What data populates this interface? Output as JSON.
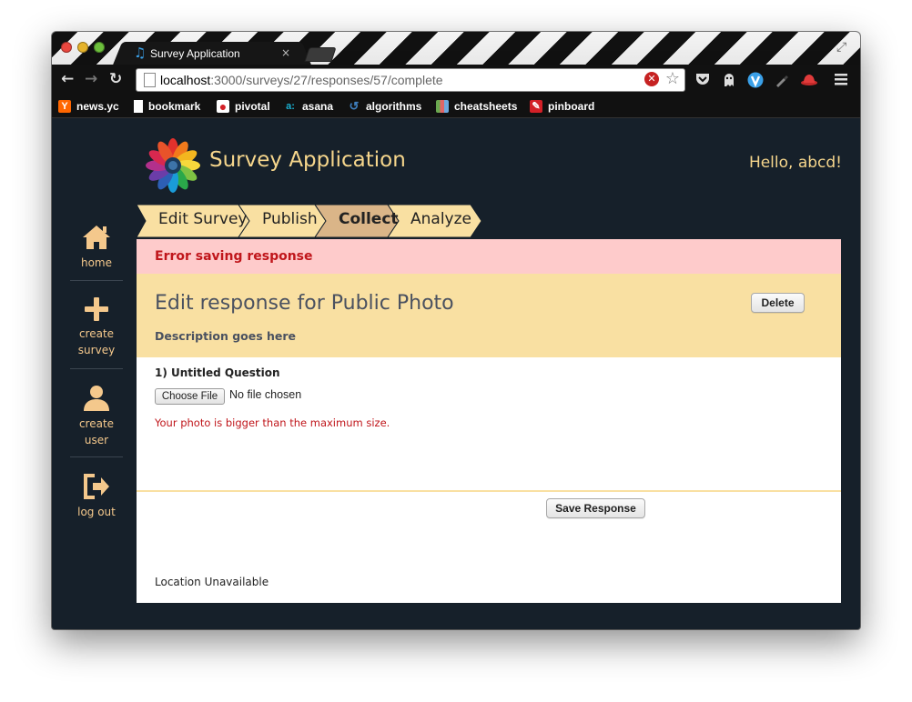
{
  "browser": {
    "tab_title": "Survey Application",
    "tab_close": "×",
    "url_host": "localhost",
    "url_rest": ":3000/surveys/27/responses/57/complete",
    "bookmarks": [
      {
        "label": "news.yc",
        "icon": "y-combinator-icon",
        "color": "#ff6600",
        "glyph": "Y"
      },
      {
        "label": "bookmark",
        "icon": "page-icon",
        "color": "#ffffff",
        "glyph": ""
      },
      {
        "label": "pivotal",
        "icon": "pivotal-icon",
        "color": "#d32027",
        "glyph": "●"
      },
      {
        "label": "asana",
        "icon": "asana-icon",
        "color": "#1aafd0",
        "glyph": "a:"
      },
      {
        "label": "algorithms",
        "icon": "algorithms-icon",
        "color": "#3f7fbf",
        "glyph": "↺"
      },
      {
        "label": "cheatsheets",
        "icon": "cheatsheets-icon",
        "color": "#6aa84f",
        "glyph": "▥"
      },
      {
        "label": "pinboard",
        "icon": "pinboard-icon",
        "color": "#d32027",
        "glyph": "✎"
      }
    ]
  },
  "sidebar": {
    "items": [
      {
        "label": "home",
        "icon": "home-icon"
      },
      {
        "label": "create\nsurvey",
        "icon": "plus-icon"
      },
      {
        "label": "create\nuser",
        "icon": "user-icon"
      },
      {
        "label": "log out",
        "icon": "logout-icon"
      }
    ]
  },
  "header": {
    "app_title": "Survey Application",
    "greeting": "Hello, abcd!"
  },
  "steps": [
    {
      "label": "Edit Survey",
      "active": false
    },
    {
      "label": "Publish",
      "active": false
    },
    {
      "label": "Collect",
      "active": true
    },
    {
      "label": "Analyze",
      "active": false
    }
  ],
  "alert": {
    "message": "Error saving response"
  },
  "response": {
    "title": "Edit response for Public Photo",
    "description": "Description goes here",
    "delete_label": "Delete",
    "question_label": "1) Untitled Question",
    "choose_file_label": "Choose File",
    "no_file_text": "No file chosen",
    "field_error": "Your photo is bigger than the maximum size.",
    "save_label": "Save Response",
    "location_text": "Location Unavailable"
  },
  "colors": {
    "background": "#16202a",
    "accent": "#f6d68c",
    "step_fill": "#f9e0a2",
    "step_active_fill": "#dab588",
    "error_bg": "#fecbcb",
    "error_text": "#c0161b"
  }
}
